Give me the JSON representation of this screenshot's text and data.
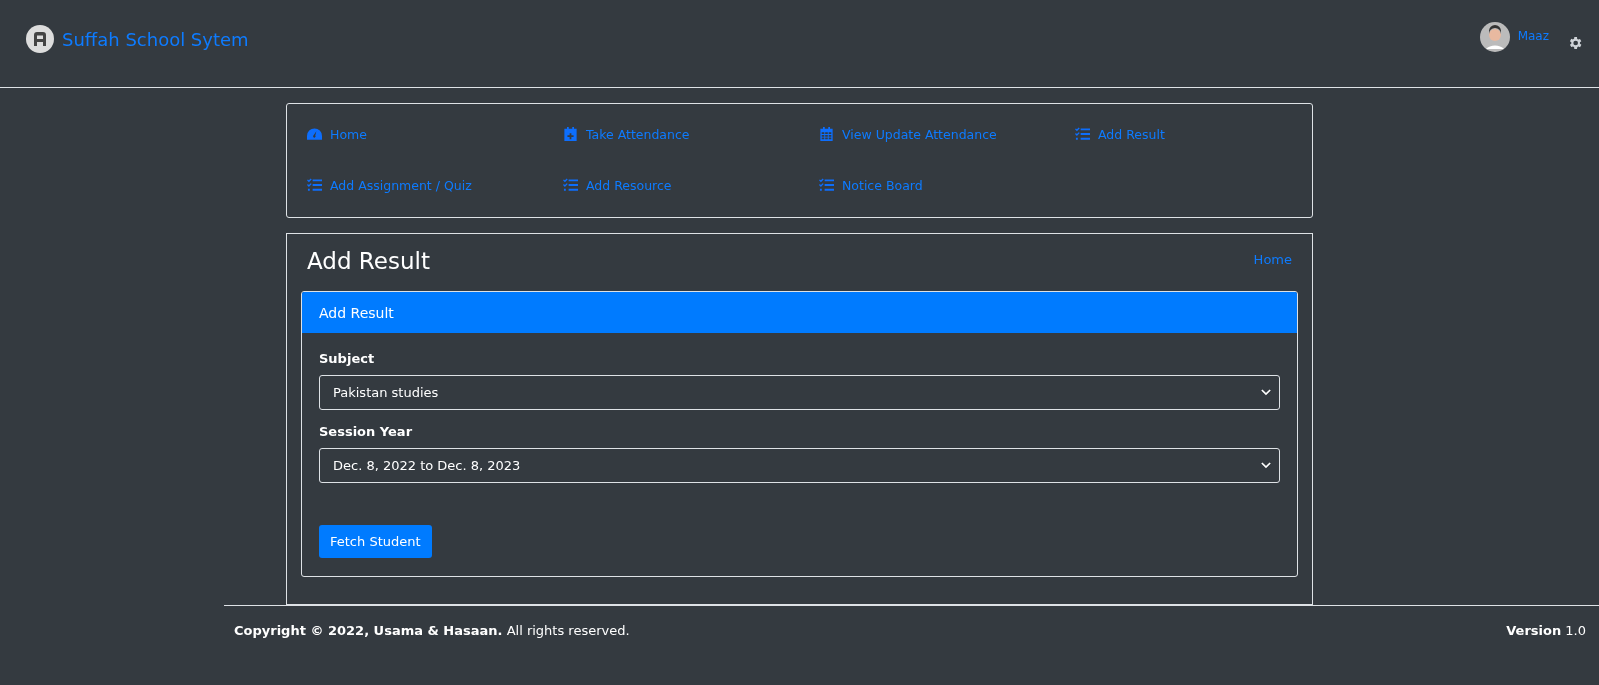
{
  "header": {
    "brand": "Suffah School Sytem",
    "user": {
      "name": "Maaz"
    }
  },
  "nav": [
    {
      "label": "Home",
      "kind": "gauge"
    },
    {
      "label": "Take Attendance",
      "kind": "calendar-plus"
    },
    {
      "label": "View Update Attendance",
      "kind": "calendar"
    },
    {
      "label": "Add Result",
      "kind": "list"
    },
    {
      "label": "Add Assignment / Quiz",
      "kind": "list"
    },
    {
      "label": "Add Resource",
      "kind": "list"
    },
    {
      "label": "Notice Board",
      "kind": "list"
    }
  ],
  "page": {
    "title": "Add Result",
    "breadcrumb": "Home"
  },
  "form": {
    "title": "Add Result",
    "fields": [
      {
        "label": "Subject",
        "value": "Pakistan studies"
      },
      {
        "label": "Session Year",
        "value": "Dec. 8, 2022 to Dec. 8, 2023"
      }
    ],
    "button": "Fetch Student"
  },
  "footer": {
    "copyright": "**Copyright © 2022, Usama & Hasaan.** All rights reserved.",
    "version": "**Version** 1.0"
  }
}
